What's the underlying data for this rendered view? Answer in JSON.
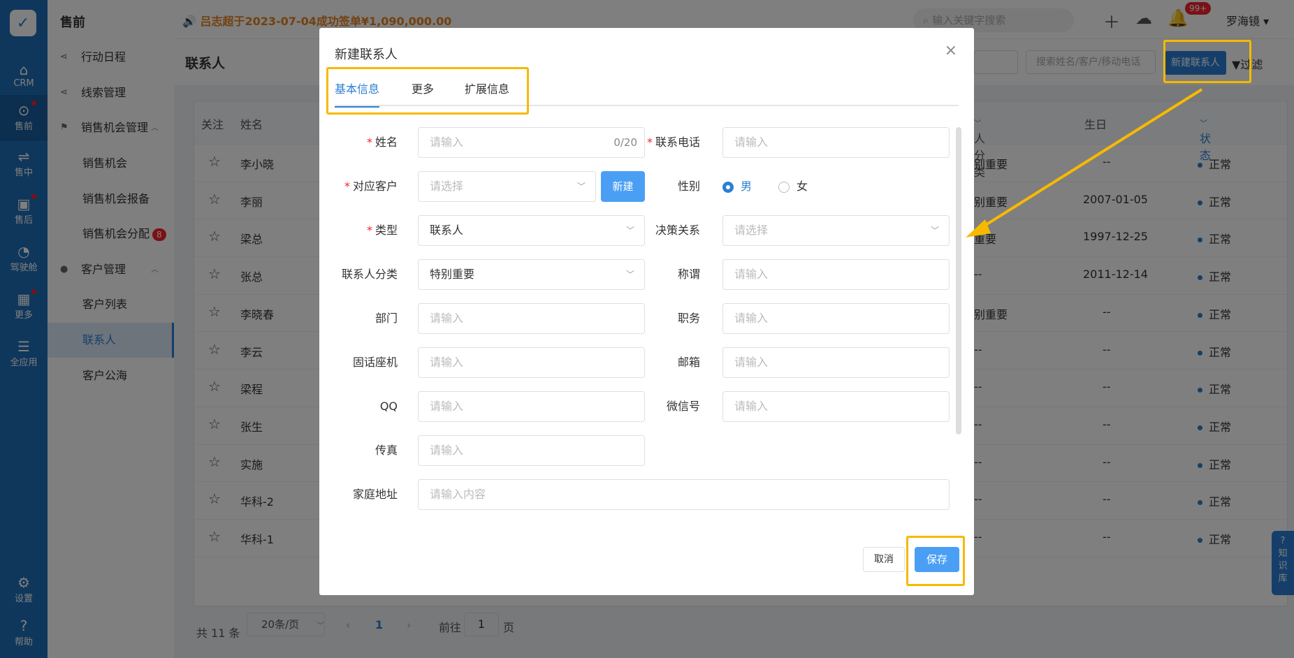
{
  "rail": {
    "items": [
      {
        "label": "CRM",
        "icon": "home-icon"
      },
      {
        "label": "售前",
        "icon": "pin-icon"
      },
      {
        "label": "售中",
        "icon": "handshake-icon"
      },
      {
        "label": "售后",
        "icon": "box-icon"
      },
      {
        "label": "驾驶舱",
        "icon": "dashboard-icon"
      },
      {
        "label": "更多",
        "icon": "grid-icon"
      },
      {
        "label": "全应用",
        "icon": "menu-icon"
      }
    ],
    "settings": "设置",
    "help": "帮助"
  },
  "subnav": {
    "title": "售前",
    "items": [
      "行动日程",
      "线索管理",
      "销售机会管理",
      "销售机会",
      "销售机会报备",
      "销售机会分配",
      "客户管理",
      "客户列表",
      "联系人",
      "客户公海"
    ],
    "badge": "8"
  },
  "topbar": {
    "announcement": "吕志超于2023-07-04成功签单¥1,090,000.00",
    "search_placeholder": "输入关键字搜索",
    "notif_badge": "99+",
    "user": "罗海镜"
  },
  "page": {
    "title": "联系人",
    "search_placeholder": "搜索姓名/客户/移动电话",
    "new_button": "新建联系人",
    "filter": "过滤"
  },
  "table": {
    "headers": {
      "follow": "关注",
      "name": "姓名",
      "category": "人分类",
      "birthday": "生日",
      "status": "状态"
    },
    "rows": [
      {
        "name": "李小晓",
        "category": "别重要",
        "birthday": "--",
        "status": "正常"
      },
      {
        "name": "李丽",
        "category": "别重要",
        "birthday": "2007-01-05",
        "status": "正常"
      },
      {
        "name": "梁总",
        "category": "重要",
        "birthday": "1997-12-25",
        "status": "正常"
      },
      {
        "name": "张总",
        "category": "--",
        "birthday": "2011-12-14",
        "status": "正常"
      },
      {
        "name": "李晓春",
        "category": "别重要",
        "birthday": "--",
        "status": "正常"
      },
      {
        "name": "李云",
        "category": "--",
        "birthday": "--",
        "status": "正常"
      },
      {
        "name": "梁程",
        "category": "--",
        "birthday": "--",
        "status": "正常"
      },
      {
        "name": "张生",
        "category": "--",
        "birthday": "--",
        "status": "正常"
      },
      {
        "name": "实施",
        "category": "--",
        "birthday": "--",
        "status": "正常"
      },
      {
        "name": "华科-2",
        "category": "--",
        "birthday": "--",
        "status": "正常"
      },
      {
        "name": "华科-1",
        "category": "--",
        "birthday": "--",
        "status": "正常"
      }
    ]
  },
  "pager": {
    "total": "共 11 条",
    "page_size": "20条/页",
    "current": "1",
    "goto_prefix": "前往",
    "goto_value": "1",
    "goto_suffix": "页"
  },
  "help_tab": "知识库",
  "modal": {
    "title": "新建联系人",
    "tabs": [
      "基本信息",
      "更多",
      "扩展信息"
    ],
    "fields": {
      "name": {
        "label": "姓名",
        "placeholder": "请输入",
        "counter": "0/20"
      },
      "phone": {
        "label": "联系电话",
        "placeholder": "请输入"
      },
      "customer": {
        "label": "对应客户",
        "placeholder": "请选择",
        "new_button": "新建"
      },
      "gender": {
        "label": "性别",
        "options": [
          "男",
          "女"
        ]
      },
      "type": {
        "label": "类型",
        "value": "联系人"
      },
      "decision": {
        "label": "决策关系",
        "placeholder": "请选择"
      },
      "category": {
        "label": "联系人分类",
        "value": "特别重要"
      },
      "title": {
        "label": "称谓",
        "placeholder": "请输入"
      },
      "department": {
        "label": "部门",
        "placeholder": "请输入"
      },
      "position": {
        "label": "职务",
        "placeholder": "请输入"
      },
      "landline": {
        "label": "固话座机",
        "placeholder": "请输入"
      },
      "email": {
        "label": "邮箱",
        "placeholder": "请输入"
      },
      "qq": {
        "label": "QQ",
        "placeholder": "请输入"
      },
      "wechat": {
        "label": "微信号",
        "placeholder": "请输入"
      },
      "fax": {
        "label": "传真",
        "placeholder": "请输入"
      },
      "address": {
        "label": "家庭地址",
        "placeholder": "请输入内容"
      }
    },
    "cancel": "取消",
    "save": "保存"
  },
  "colors": {
    "primary": "#2b7fd4",
    "highlight": "#f7b900",
    "announcement": "#e6821e"
  }
}
